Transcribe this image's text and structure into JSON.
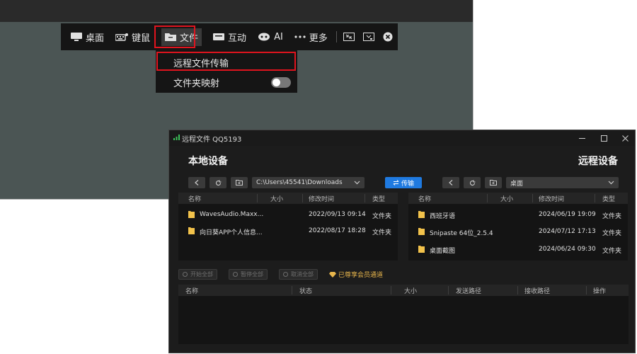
{
  "toolbar": {
    "items": [
      {
        "label": "桌面",
        "icon": "monitor-icon"
      },
      {
        "label": "键鼠",
        "icon": "keyboard-icon"
      },
      {
        "label": "文件",
        "icon": "folder-icon"
      },
      {
        "label": "互动",
        "icon": "chat-icon"
      },
      {
        "label": "AI",
        "icon": "ai-icon"
      },
      {
        "label": "更多",
        "icon": "more-dots-icon"
      }
    ],
    "extra_icons": [
      "shrink-icon",
      "screen-icon",
      "close-circle-icon"
    ]
  },
  "file_menu": {
    "items": [
      {
        "label": "远程文件传输"
      },
      {
        "label": "文件夹映射",
        "toggle_on": false
      }
    ]
  },
  "window": {
    "title": "远程文件 QQ5193",
    "local": {
      "title": "本地设备",
      "path": "C:\\Users\\45541\\Downloads",
      "columns": [
        "名称",
        "大小",
        "修改时间",
        "类型"
      ],
      "rows": [
        {
          "name": "WavesAudio.Maxx...",
          "size": "",
          "modified": "2022/09/13 09:14",
          "type": "文件夹"
        },
        {
          "name": "向日葵APP个人信息...",
          "size": "",
          "modified": "2022/08/17 18:28",
          "type": "文件夹"
        }
      ]
    },
    "transfer_label": "传输",
    "remote": {
      "title": "远程设备",
      "path": "桌面",
      "columns": [
        "名称",
        "大小",
        "修改时间",
        "类型"
      ],
      "rows": [
        {
          "name": "西班牙语",
          "size": "",
          "modified": "2024/06/19 19:09",
          "type": "文件夹"
        },
        {
          "name": "Snipaste 64位_2.5.4",
          "size": "",
          "modified": "2024/07/12 17:13",
          "type": "文件夹"
        },
        {
          "name": "桌面截图",
          "size": "",
          "modified": "2024/06/24 09:30",
          "type": "文件夹"
        }
      ]
    },
    "actions": [
      "开始全部",
      "暂停全部",
      "取消全部"
    ],
    "vip_label": "已尊享会员通道",
    "transfer_columns": [
      "名称",
      "状态",
      "大小",
      "发送路径",
      "接收路径",
      "操作"
    ]
  },
  "colors": {
    "highlight": "#e0141e",
    "accent": "#1f7ae0",
    "vip": "#e8b64c"
  }
}
